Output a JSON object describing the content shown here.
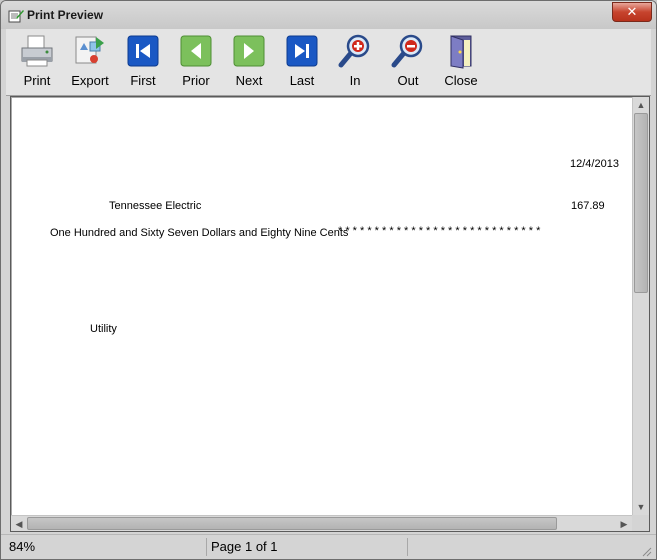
{
  "window": {
    "title": "Print Preview",
    "close_glyph": "✕"
  },
  "toolbar": {
    "buttons": [
      {
        "label": "Print",
        "icon": "printer-icon"
      },
      {
        "label": "Export",
        "icon": "export-icon"
      },
      {
        "label": "First",
        "icon": "first-page-icon"
      },
      {
        "label": "Prior",
        "icon": "prior-page-icon"
      },
      {
        "label": "Next",
        "icon": "next-page-icon"
      },
      {
        "label": "Last",
        "icon": "last-page-icon"
      },
      {
        "label": "In",
        "icon": "zoom-in-icon"
      },
      {
        "label": "Out",
        "icon": "zoom-out-icon"
      },
      {
        "label": "Close",
        "icon": "door-exit-icon"
      }
    ]
  },
  "document": {
    "date": "12/4/2013",
    "payee": "Tennessee Electric",
    "amount": "167.89",
    "amount_words": "One Hundred and Sixty Seven Dollars and Eighty Nine Cents",
    "fill_stars": "* * * * * * * * * * * * * * * * * * * * * * * * * * * *",
    "memo": "Utility"
  },
  "status": {
    "zoom": "84%",
    "page": "Page 1 of 1"
  },
  "colors": {
    "nav_blue": "#1a58c4",
    "nav_green": "#66b84a",
    "zoom_red": "#d0281c"
  }
}
